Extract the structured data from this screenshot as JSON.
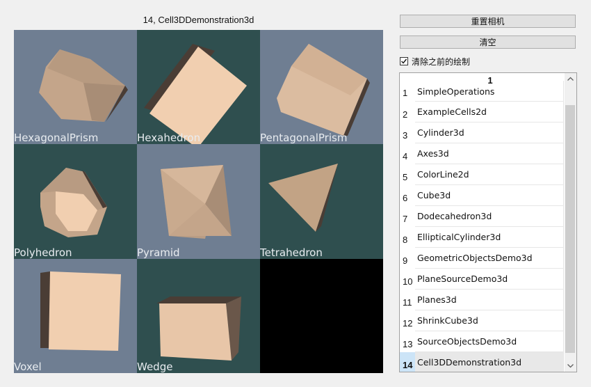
{
  "view_title": "14, Cell3DDemonstration3d",
  "colors": {
    "slate": "#6f7e92",
    "teal": "#2f4f4f",
    "black": "#000000",
    "face_light": "#f1cfb0",
    "face_mid": "#c4a58a",
    "face_dark": "#4a3d35"
  },
  "cells": [
    {
      "label": "HexagonalPrism",
      "bg": "slate"
    },
    {
      "label": "Hexahedron",
      "bg": "teal"
    },
    {
      "label": "PentagonalPrism",
      "bg": "slate"
    },
    {
      "label": "Polyhedron",
      "bg": "teal"
    },
    {
      "label": "Pyramid",
      "bg": "slate"
    },
    {
      "label": "Tetrahedron",
      "bg": "teal"
    },
    {
      "label": "Voxel",
      "bg": "slate"
    },
    {
      "label": "Wedge",
      "bg": "teal"
    },
    {
      "label": "",
      "bg": "black"
    }
  ],
  "controls": {
    "reset_camera": "重置相机",
    "clear": "清空",
    "clear_previous_label": "清除之前的绘制",
    "clear_previous_checked": true
  },
  "list": {
    "column_header": "1",
    "selected_index": 14,
    "items": [
      {
        "num": "1",
        "name": "SimpleOperations"
      },
      {
        "num": "2",
        "name": "ExampleCells2d"
      },
      {
        "num": "3",
        "name": "Cylinder3d"
      },
      {
        "num": "4",
        "name": "Axes3d"
      },
      {
        "num": "5",
        "name": "ColorLine2d"
      },
      {
        "num": "6",
        "name": "Cube3d"
      },
      {
        "num": "7",
        "name": "Dodecahedron3d"
      },
      {
        "num": "8",
        "name": "EllipticalCylinder3d"
      },
      {
        "num": "9",
        "name": "GeometricObjectsDemo3d"
      },
      {
        "num": "10",
        "name": "PlaneSourceDemo3d"
      },
      {
        "num": "11",
        "name": "Planes3d"
      },
      {
        "num": "12",
        "name": "ShrinkCube3d"
      },
      {
        "num": "13",
        "name": "SourceObjectsDemo3d"
      },
      {
        "num": "14",
        "name": "Cell3DDemonstration3d"
      }
    ]
  }
}
